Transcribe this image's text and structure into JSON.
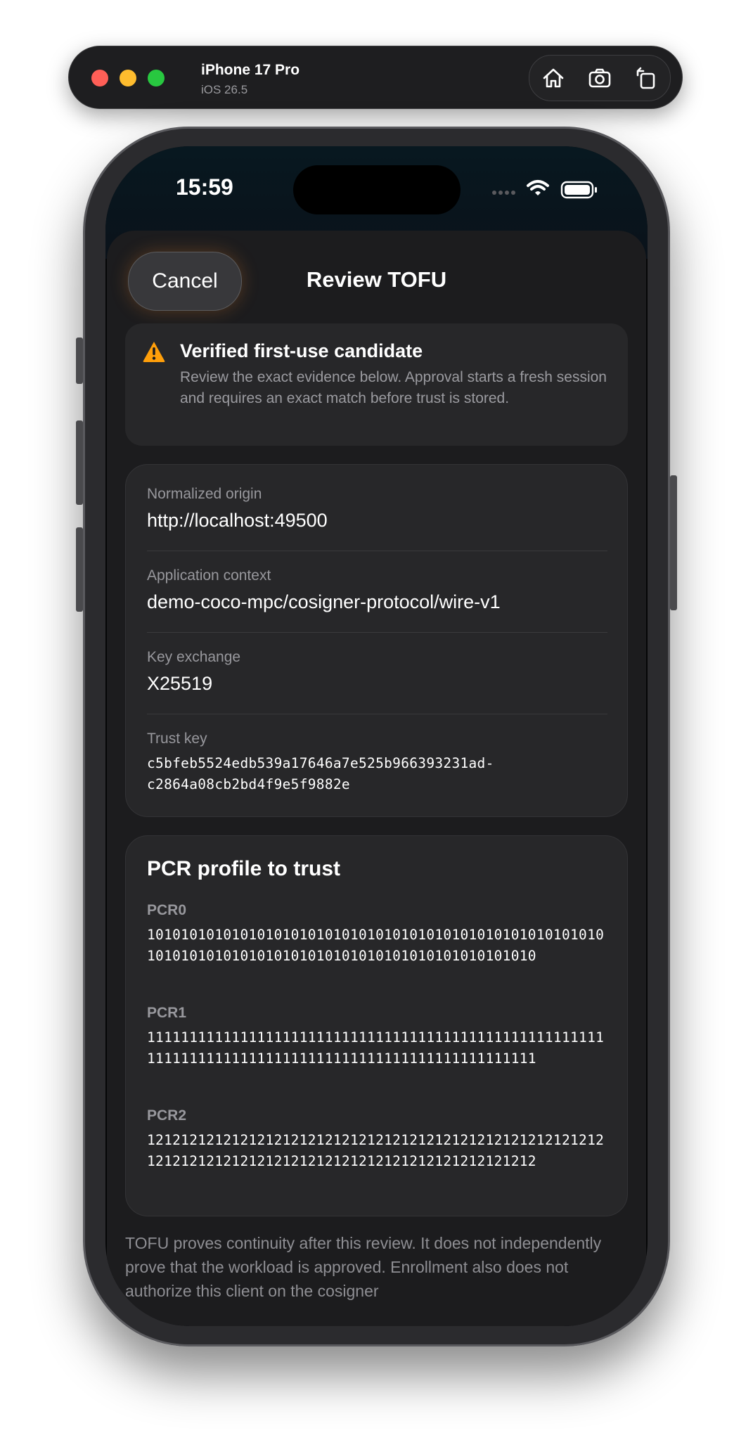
{
  "simulator": {
    "device_name": "iPhone 17 Pro",
    "os_version": "iOS 26.5",
    "controls": [
      "home-icon",
      "screenshot-icon",
      "rotate-icon"
    ]
  },
  "status_bar": {
    "time": "15:59",
    "icons": [
      "signal-icon",
      "wifi-icon",
      "battery-icon"
    ]
  },
  "nav": {
    "cancel_label": "Cancel",
    "title": "Review TOFU"
  },
  "warning": {
    "icon": "warning-triangle-icon",
    "title": "Verified first-use candidate",
    "body": "Review the exact evidence below. Approval starts a fresh session and requires an exact match before trust is stored."
  },
  "details": [
    {
      "label": "Normalized origin",
      "value": "http://localhost:49500"
    },
    {
      "label": "Application context",
      "value": "demo-coco-mpc/cosigner-protocol/wire-v1"
    },
    {
      "label": "Key exchange",
      "value": "X25519"
    },
    {
      "label": "Trust key",
      "value_line1": "c5bfeb5524edb539a17646a7e525b966393231ad-",
      "value_line2": "c2864a08cb2bd4f9e5f9882e"
    }
  ],
  "pcr": {
    "heading": "PCR profile to trust",
    "entries": [
      {
        "label": "PCR0",
        "value": "1010101010101010101010101010101010101010101010101010101010101010101010101010101010101010101010101010"
      },
      {
        "label": "PCR1",
        "value": "1111111111111111111111111111111111111111111111111111111111111111111111111111111111111111111111111111"
      },
      {
        "label": "PCR2",
        "value": "1212121212121212121212121212121212121212121212121212121212121212121212121212121212121212121212121212"
      }
    ]
  },
  "footer": {
    "text": "TOFU proves continuity after this review. It does not independently prove that the workload is approved. Enrollment also does not authorize this client on the cosigner"
  },
  "colors": {
    "accent_warning": "#ff9f0a",
    "card_background": "#272729",
    "sheet_background": "#1c1c1e"
  }
}
